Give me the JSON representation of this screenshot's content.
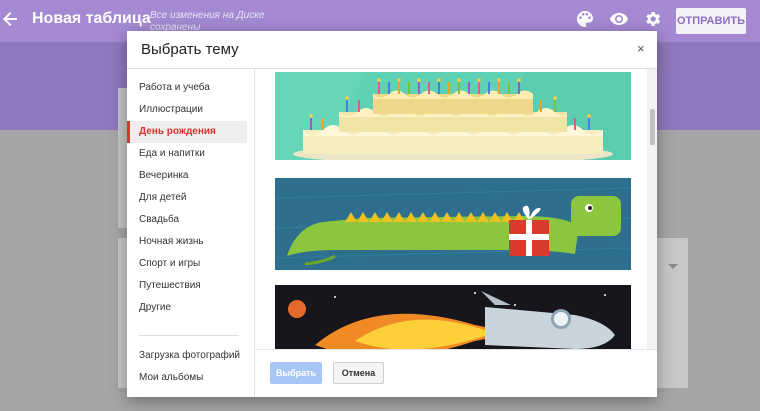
{
  "header": {
    "back_icon": "arrow-left-icon",
    "title": "Новая таблица",
    "save_status": "Все изменения на Диске сохранены",
    "icons": [
      "palette-icon",
      "eye-icon",
      "gear-icon"
    ],
    "send_label": "ОТПРАВИТЬ"
  },
  "colors": {
    "header_bg": "#a58ad3",
    "band_bg": "#8f78bd",
    "active_category": "#d9352b",
    "primary_button": "#a8c6f5"
  },
  "dialog": {
    "title": "Выбрать тему",
    "close_label": "×",
    "categories": [
      {
        "label": "Работа и учеба",
        "active": false
      },
      {
        "label": "Иллюстрации",
        "active": false
      },
      {
        "label": "День рождения",
        "active": true
      },
      {
        "label": "Еда и напитки",
        "active": false
      },
      {
        "label": "Вечеринка",
        "active": false
      },
      {
        "label": "Для детей",
        "active": false
      },
      {
        "label": "Свадьба",
        "active": false
      },
      {
        "label": "Ночная жизнь",
        "active": false
      },
      {
        "label": "Спорт и игры",
        "active": false
      },
      {
        "label": "Путешествия",
        "active": false
      },
      {
        "label": "Другие",
        "active": false
      }
    ],
    "extra_links": [
      {
        "label": "Загрузка фотографий"
      },
      {
        "label": "Мои альбомы"
      }
    ],
    "themes": [
      {
        "name": "birthday-cake-theme"
      },
      {
        "name": "dragon-gift-theme"
      },
      {
        "name": "rocket-space-theme"
      }
    ],
    "select_label": "Выбрать",
    "cancel_label": "Отмена"
  }
}
